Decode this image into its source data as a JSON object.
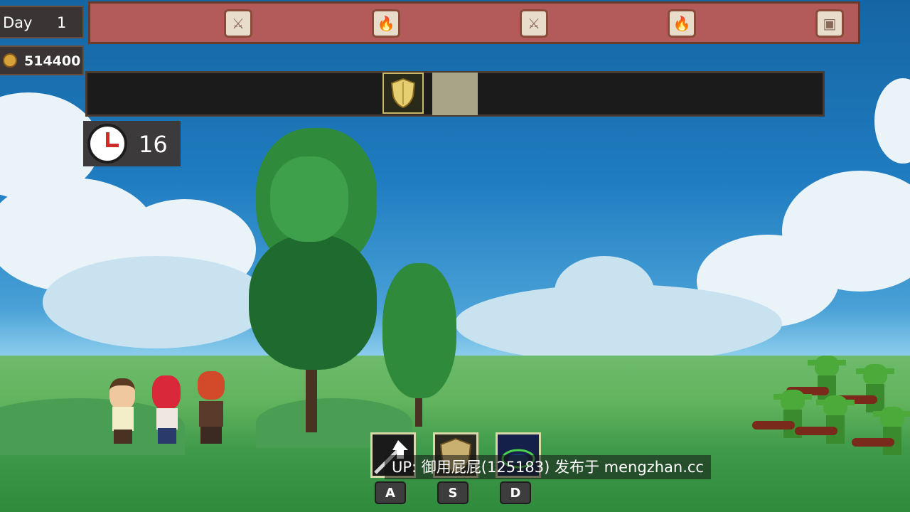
{
  "hud": {
    "day_label": "Day",
    "day_number": "1",
    "gold": "514400",
    "timer": "16"
  },
  "track": {
    "nodes": [
      "sword-icon",
      "campfire-icon",
      "sword-icon",
      "campfire-icon",
      "treasure-icon"
    ]
  },
  "skills": {
    "keys": [
      "A",
      "S",
      "D"
    ],
    "icons": [
      "upgrade-arrow-icon",
      "shield-icon",
      "magic-circle-icon"
    ]
  },
  "watermark": "UP: 御用屁屁(125183) 发布于 mengzhan.cc",
  "colors": {
    "track_bg": "#b35b5b",
    "bar_bg": "#1b1b1b",
    "cursor": "#a7a487",
    "goblin": "#4caa3a"
  }
}
